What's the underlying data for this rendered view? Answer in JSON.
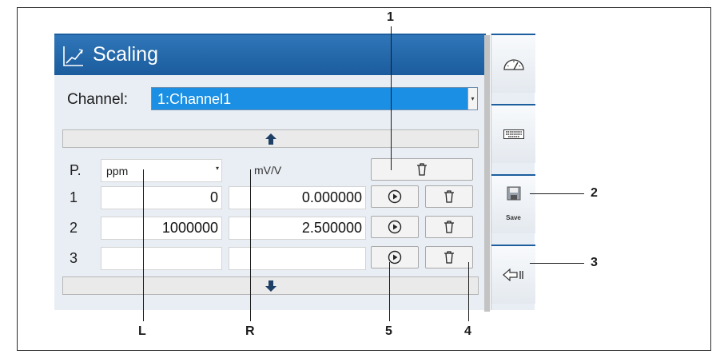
{
  "window": {
    "title": "Scaling",
    "title_icon": "scaling-chart-icon"
  },
  "channel": {
    "label": "Channel:",
    "value": "1:Channel1"
  },
  "table": {
    "header": {
      "p_label": "P.",
      "left_unit": "ppm",
      "right_unit": "mV/V"
    },
    "rows": [
      {
        "p": "1",
        "left": "0",
        "right": "0.000000"
      },
      {
        "p": "2",
        "left": "1000000",
        "right": "2.500000"
      },
      {
        "p": "3",
        "left": "",
        "right": ""
      }
    ]
  },
  "side_panel": {
    "save_label": "Save"
  },
  "callouts": {
    "c1": "1",
    "c2": "2",
    "c3": "3",
    "c4": "4",
    "c5": "5",
    "cL": "L",
    "cR": "R"
  },
  "colors": {
    "title_bar": "#1d5e9e",
    "selected_channel": "#1a8fe3",
    "panel_bg": "#e9eef4"
  }
}
